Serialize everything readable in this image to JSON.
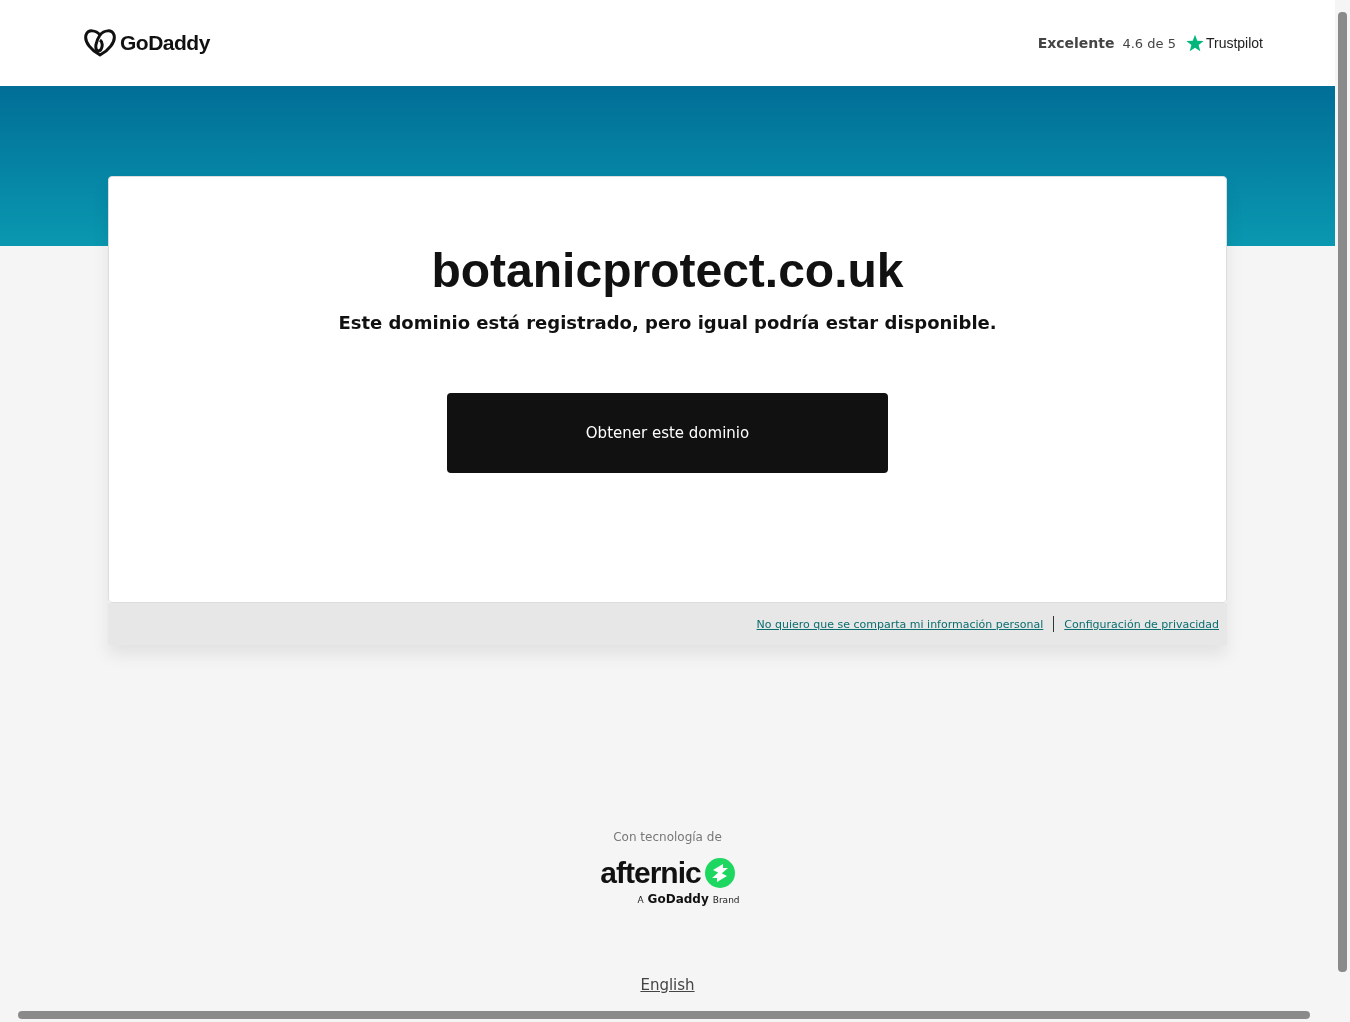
{
  "header": {
    "logo_text": "GoDaddy",
    "rating": {
      "label": "Excelente",
      "score": "4.6 de 5",
      "brand": "Trustpilot"
    }
  },
  "card": {
    "domain": "botanicprotect.co.uk",
    "message": "Este dominio está registrado, pero igual podría estar disponible.",
    "button": "Obtener este dominio"
  },
  "privacy_links": [
    "No quiero que se comparta mi información personal",
    "Configuración de privacidad"
  ],
  "footer": {
    "powered_by": "Con tecnología de",
    "brand": "afternic",
    "sub_brand": {
      "prefix": "A",
      "name": "GoDaddy",
      "suffix": "Brand"
    },
    "language": "English"
  }
}
